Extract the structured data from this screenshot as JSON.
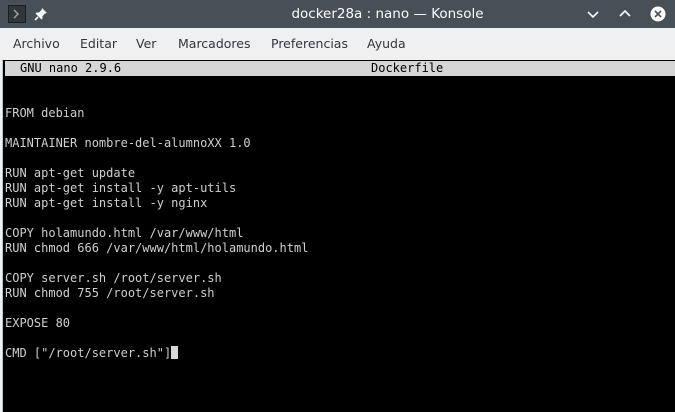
{
  "window": {
    "title": "docker28a : nano — Konsole"
  },
  "menu": [
    {
      "label": "Archivo"
    },
    {
      "label": "Editar"
    },
    {
      "label": "Ver"
    },
    {
      "label": "Marcadores"
    },
    {
      "label": "Preferencias"
    },
    {
      "label": "Ayuda"
    }
  ],
  "nano": {
    "version": "GNU nano 2.9.6",
    "filename": "Dockerfile"
  },
  "lines": [
    "",
    "",
    "FROM debian",
    "",
    "MAINTAINER nombre-del-alumnoXX 1.0",
    "",
    "RUN apt-get update",
    "RUN apt-get install -y apt-utils",
    "RUN apt-get install -y nginx",
    "",
    "COPY holamundo.html /var/www/html",
    "RUN chmod 666 /var/www/html/holamundo.html",
    "",
    "COPY server.sh /root/server.sh",
    "RUN chmod 755 /root/server.sh",
    "",
    "EXPOSE 80",
    "",
    "CMD [\"/root/server.sh\"]"
  ],
  "colors": {
    "titlebar": "#475057",
    "terminal_bg": "#000000",
    "terminal_fg": "#cfcfcf",
    "nano_header_bg": "#d6d6d6"
  },
  "icons": {
    "app": "terminal-icon",
    "pin": "pin-icon",
    "minimize": "minimize-icon",
    "maximize": "maximize-icon",
    "close": "close-icon"
  }
}
